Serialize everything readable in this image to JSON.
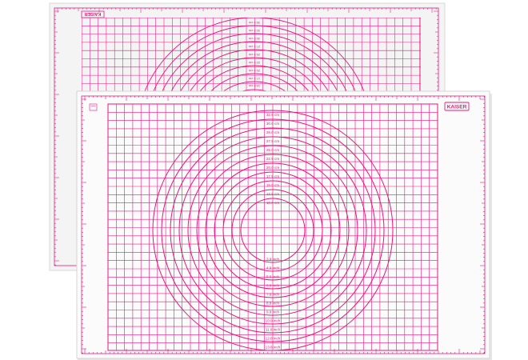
{
  "colors": {
    "magenta": "#e5177e",
    "mat": "#fbfbfb",
    "mat_back": "#f4f4f4",
    "edge": "#d9d9d9"
  },
  "front_mat": {
    "brand": "KAISER",
    "cm_labels": [
      "32.5 cm",
      "30.0 cm",
      "28.0 cm",
      "27.5 cm",
      "25.0 cm",
      "22.5 cm",
      "20.0 cm",
      "17.5 cm",
      "15.0 cm",
      "12.5 cm",
      "10.0 cm"
    ],
    "inch_labels": [
      "3.9 inch",
      "4.9 inch",
      "5.9 inch",
      "6.9 inch",
      "7.9 inch",
      "8.9 inch",
      "9.9 inch",
      "10.9 inch",
      "11.9 inch",
      "12.8 inch",
      "13.8 inch"
    ]
  },
  "back_mat": {
    "brand": "KAISER",
    "cm_labels": [
      "35.0 cm",
      "32.5 cm",
      "30.0 cm",
      "27.5 cm",
      "25.0 cm",
      "22.5 cm",
      "20.0 cm",
      "17.5 cm",
      "15.0 cm"
    ]
  }
}
